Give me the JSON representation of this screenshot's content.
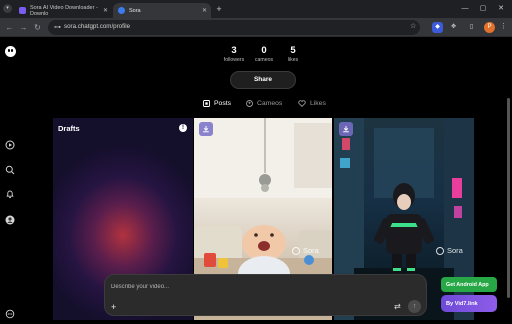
{
  "browser": {
    "tabs": [
      {
        "label": "Sora AI Video Downloader - Downlo",
        "close": "✕"
      },
      {
        "label": "Sora",
        "close": "✕"
      }
    ],
    "new_tab": "+",
    "window_controls": [
      "—",
      "▢",
      "✕"
    ],
    "url": "sora.chatgpt.com/profile",
    "profile_initial": "P"
  },
  "profile": {
    "stats": [
      {
        "num": "3",
        "label": "followers"
      },
      {
        "num": "0",
        "label": "cameos"
      },
      {
        "num": "5",
        "label": "likes"
      }
    ],
    "share_label": "Share",
    "tabs": [
      {
        "label": "Posts",
        "icon": "grid-icon"
      },
      {
        "label": "Cameos",
        "icon": "cameo-icon"
      },
      {
        "label": "Likes",
        "icon": "heart-icon"
      }
    ]
  },
  "grid": {
    "drafts_label": "Drafts",
    "drafts_info": "!",
    "watermark": "Sora"
  },
  "composer": {
    "placeholder": "Describe your video...",
    "add": "+",
    "settings": "⇄",
    "send": "↑"
  },
  "extension_buttons": {
    "android": "Get Android App",
    "vid7": "By Vid7.link"
  }
}
